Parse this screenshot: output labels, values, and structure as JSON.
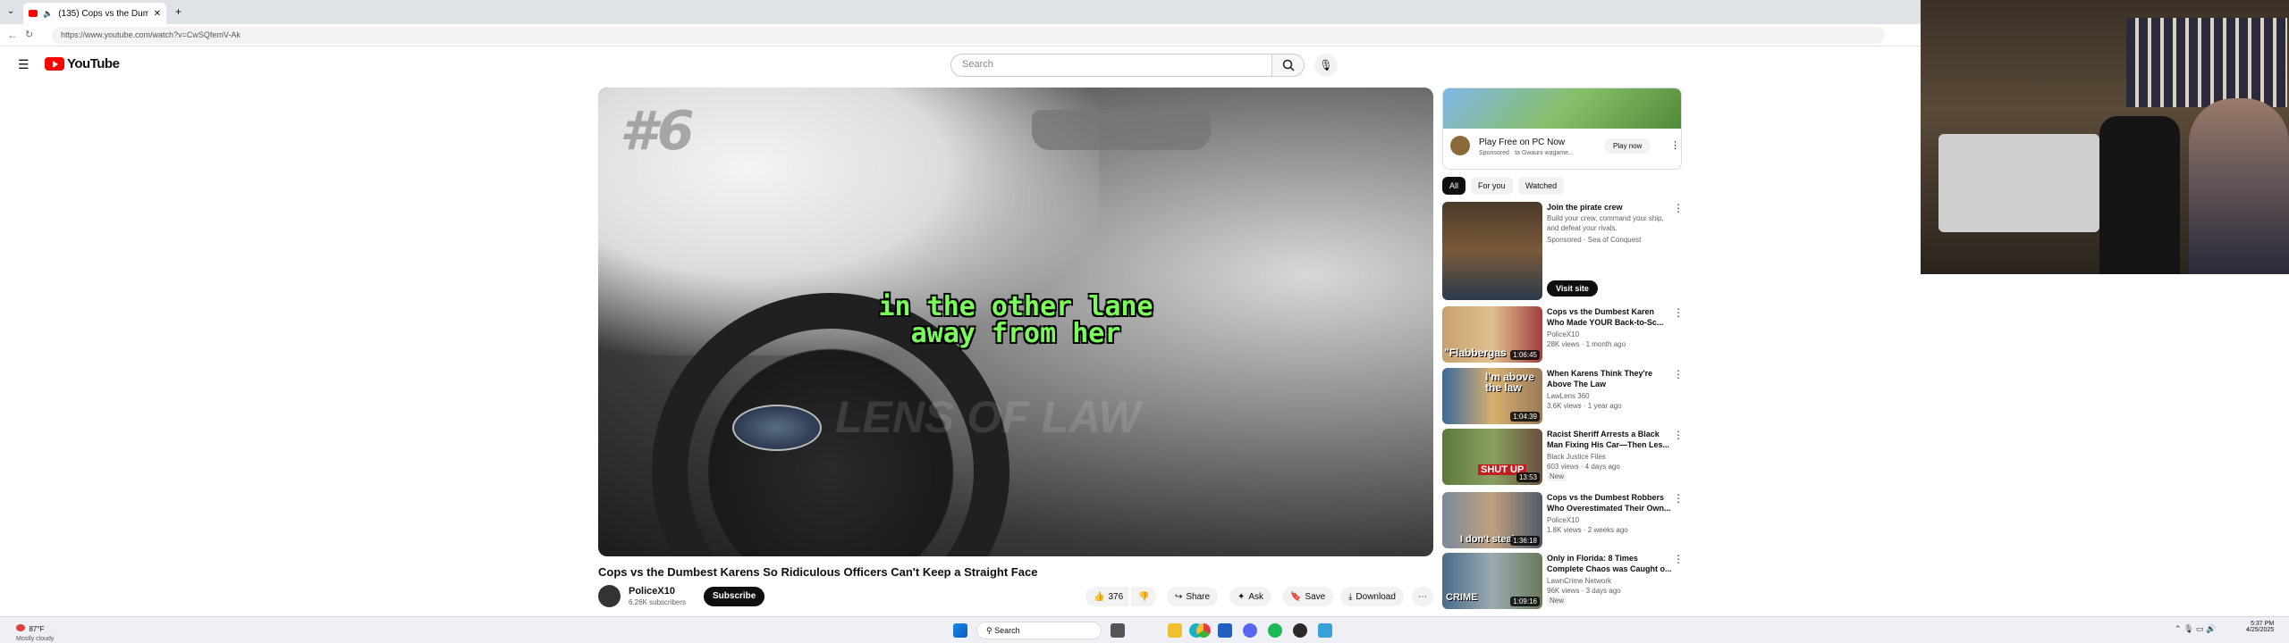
{
  "browser": {
    "tab_title": "(135) Cops vs the Dumbest K...",
    "new_tab": "+",
    "url": "https://www.youtube.com/watch?v=CwSQfemV-Ak"
  },
  "youtube": {
    "logo_text": "YouTube",
    "search_placeholder": "Search"
  },
  "video": {
    "episode_badge": "#6",
    "subtitle_line1": "in the other lane",
    "subtitle_line2": "away from her",
    "watermark": "LENS OF LAW",
    "title": "Cops vs the Dumbest Karens So Ridiculous Officers Can't Keep a Straight Face",
    "channel": "PoliceX10",
    "subscribers": "6.26K subscribers",
    "subscribe_label": "Subscribe",
    "likes": "376",
    "share_label": "Share",
    "ask_label": "Ask",
    "save_label": "Save",
    "download_label": "Download"
  },
  "sidebar": {
    "ad": {
      "title": "Play Free on PC Now",
      "sponsor": "Sponsored · ta Gwauni wagame...",
      "cta": "Play now"
    },
    "chips": [
      "All",
      "For you",
      "Watched"
    ],
    "items": [
      {
        "title": "Join the pirate crew",
        "meta1": "Build your crew, command your ship, and defeat your rivals.",
        "meta2": "Sponsored · Sea of Conquest",
        "cta": "Visit site"
      },
      {
        "title": "Cops vs the Dumbest Karen Who Made YOUR Back-to-Sc...",
        "meta1": "PoliceX10",
        "meta2": "28K views · 1 month ago",
        "duration": "1:06:45",
        "thumb_text": "\"Flabbergas"
      },
      {
        "title": "When Karens Think They're Above The Law",
        "meta1": "LawLens 360",
        "meta2": "3.6K views · 1 year ago",
        "duration": "1:04:39",
        "thumb_text": "I'm above the law"
      },
      {
        "title": "Racist Sheriff Arrests a Black Man Fixing His Car—Then Les...",
        "meta1": "Black Justice Files",
        "meta2": "603 views · 4 days ago",
        "badge": "New",
        "duration": "13:53",
        "thumb_text": "SHUT UP"
      },
      {
        "title": "Cops vs the Dumbest Robbers Who Overestimated Their Own...",
        "meta1": "PoliceX10",
        "meta2": "1.8K views · 2 weeks ago",
        "duration": "1:36:18",
        "thumb_text": "I don't steal"
      },
      {
        "title": "Only in Florida: 8 Times Complete Chaos was Caught o...",
        "meta1": "LawnCrime Network",
        "meta2": "96K views · 3 days ago",
        "badge": "New",
        "duration": "1:09:16",
        "thumb_text": "CRIME"
      }
    ]
  },
  "taskbar": {
    "weather_temp": "87°F",
    "weather_desc": "Mostly cloudy",
    "search_label": "Search",
    "time": "5:37 PM",
    "date": "4/25/2025"
  },
  "colors": {
    "youtube_red": "#ff0000",
    "subtitle_green": "#7cfc5a",
    "taskbar_bg": "#eef0f5"
  }
}
